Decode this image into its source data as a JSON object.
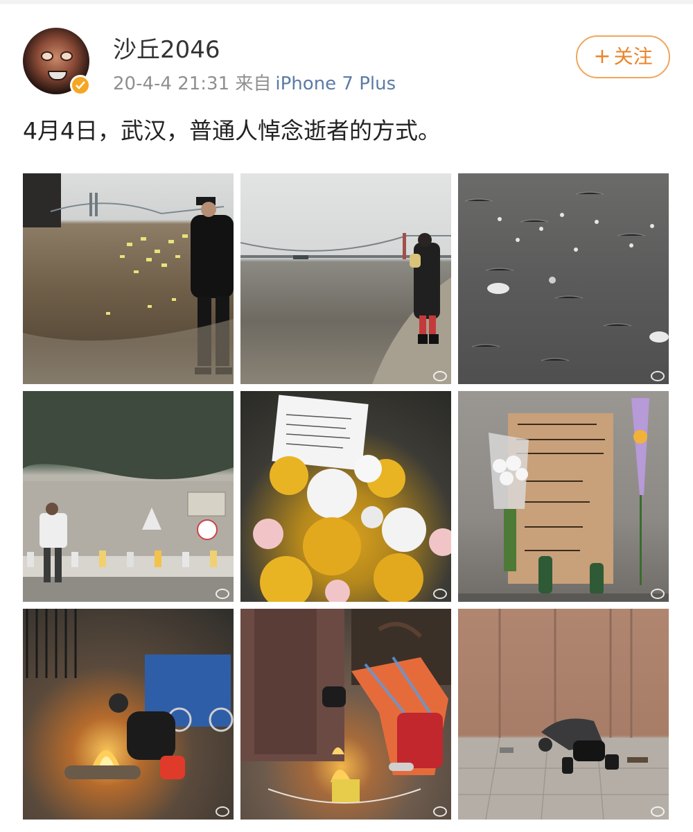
{
  "user": {
    "name": "沙丘2046",
    "verified": true
  },
  "post": {
    "timestamp": "20-4-4 21:31",
    "source_prefix": "来自",
    "source_device": "iPhone 7 Plus",
    "text": "4月4日，武汉，普通人悼念逝者的方式。"
  },
  "follow_button": {
    "plus": "+",
    "label": "关注"
  },
  "photos": [
    {
      "icon": "photo-river-paper"
    },
    {
      "icon": "photo-river-bridge"
    },
    {
      "icon": "photo-floating-flowers"
    },
    {
      "icon": "photo-wall-memorial"
    },
    {
      "icon": "photo-flower-bouquet"
    },
    {
      "icon": "photo-cardboard-sign"
    },
    {
      "icon": "photo-burning-street"
    },
    {
      "icon": "photo-burning-doorway"
    },
    {
      "icon": "photo-kneeling-person"
    }
  ],
  "colors": {
    "accent": "#e8852b",
    "link": "#5b7ba6",
    "verified_badge": "#f5a623"
  }
}
